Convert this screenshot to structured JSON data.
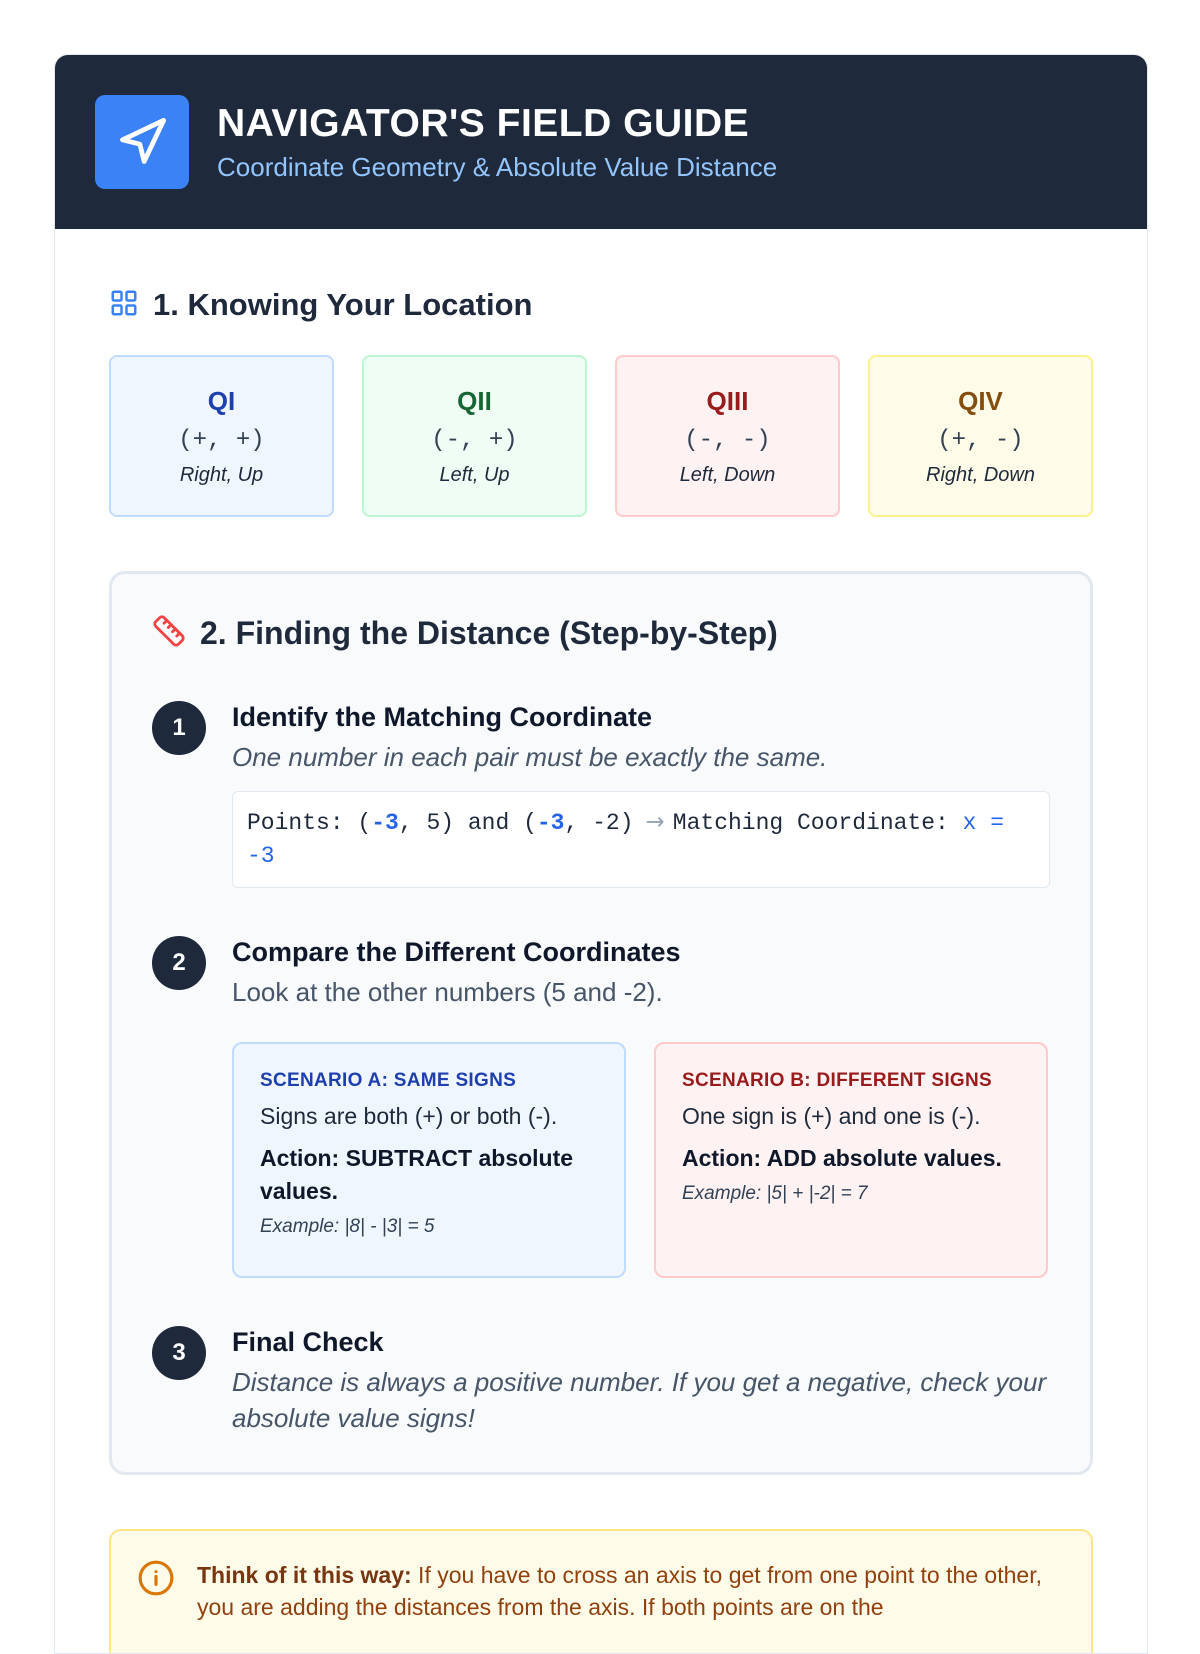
{
  "header": {
    "title": "NAVIGATOR'S FIELD GUIDE",
    "subtitle": "Coordinate Geometry & Absolute Value Distance",
    "logo_icon": "navigation-arrow-icon"
  },
  "section1": {
    "title": "1. Knowing Your Location",
    "icon": "grid-icon",
    "quadrants": [
      {
        "name": "QI",
        "signs": "(+, +)",
        "direction": "Right, Up"
      },
      {
        "name": "QII",
        "signs": "(-, +)",
        "direction": "Left, Up"
      },
      {
        "name": "QIII",
        "signs": "(-, -)",
        "direction": "Left, Down"
      },
      {
        "name": "QIV",
        "signs": "(+, -)",
        "direction": "Right, Down"
      }
    ]
  },
  "section2": {
    "title": "2. Finding the Distance (Step-by-Step)",
    "icon": "ruler-icon",
    "step1": {
      "number": "1",
      "title": "Identify the Matching Coordinate",
      "desc": "One number in each pair must be exactly the same.",
      "code": {
        "prefix": "Points: (",
        "p1x": "-3",
        "p1rest": ", 5) and (",
        "p2x": "-3",
        "p2rest": ", -2)",
        "arrow": "→",
        "match_label": "Matching Coordinate: ",
        "match_value": "x = -3"
      }
    },
    "step2": {
      "number": "2",
      "title": "Compare the Different Coordinates",
      "desc": "Look at the other numbers (5 and -2).",
      "scenario_a": {
        "title": "SCENARIO A: SAME SIGNS",
        "desc": "Signs are both (+) or both (-).",
        "action": "Action: SUBTRACT absolute values.",
        "example": "Example: |8| - |3| = 5"
      },
      "scenario_b": {
        "title": "SCENARIO B: DIFFERENT SIGNS",
        "desc": "One sign is (+) and one is (-).",
        "action": "Action: ADD absolute values.",
        "example": "Example: |5| + |-2| = 7"
      }
    },
    "step3": {
      "number": "3",
      "title": "Final Check",
      "desc": "Distance is always a positive number. If you get a negative, check your absolute value signs!"
    }
  },
  "tip": {
    "icon": "info-icon",
    "lead": "Think of it this way:",
    "text": " If you have to cross an axis to get from one point to the other, you are adding the distances from the axis. If both points are on the"
  },
  "colors": {
    "header_bg": "#1e293b",
    "accent": "#3b82f6",
    "subtitle": "#93c5fd"
  }
}
